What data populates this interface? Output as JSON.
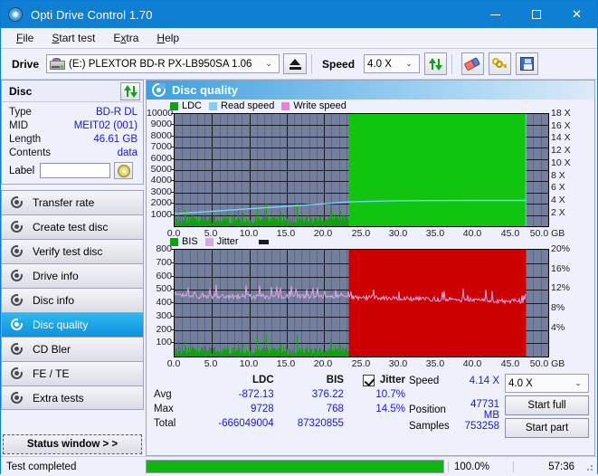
{
  "window": {
    "title": "Opti Drive Control 1.70",
    "icon": "disc-icon",
    "minimize": "minimize-icon",
    "maximize": "maximize-icon",
    "close": "close-icon"
  },
  "menu": [
    {
      "label": "File",
      "accel": "F"
    },
    {
      "label": "Start test",
      "accel": "S"
    },
    {
      "label": "Extra",
      "accel": "x"
    },
    {
      "label": "Help",
      "accel": "H"
    }
  ],
  "toolbar": {
    "drive_label": "Drive",
    "drive_value": "(E:)  PLEXTOR BD-R  PX-LB950SA 1.06",
    "eject": "eject-icon",
    "speed_label": "Speed",
    "speed_value": "4.0 X",
    "refresh": "refresh-icon",
    "erase": "eraser-icon",
    "keys": "keys-icon",
    "save": "save-icon"
  },
  "disc": {
    "header": "Disc",
    "refresh_icon": "refresh-icon",
    "rows": [
      {
        "key": "Type",
        "value": "BD-R DL"
      },
      {
        "key": "MID",
        "value": "MEIT02 (001)"
      },
      {
        "key": "Length",
        "value": "46.61 GB"
      },
      {
        "key": "Contents",
        "value": "data"
      }
    ],
    "label_key": "Label",
    "label_value": "",
    "label_placeholder": ""
  },
  "nav": {
    "items": [
      {
        "label": "Transfer rate",
        "active": false
      },
      {
        "label": "Create test disc",
        "active": false
      },
      {
        "label": "Verify test disc",
        "active": false
      },
      {
        "label": "Drive info",
        "active": false
      },
      {
        "label": "Disc info",
        "active": false
      },
      {
        "label": "Disc quality",
        "active": true
      },
      {
        "label": "CD Bler",
        "active": false
      },
      {
        "label": "FE / TE",
        "active": false
      },
      {
        "label": "Extra tests",
        "active": false
      }
    ],
    "status_window": "Status window > >"
  },
  "panel": {
    "title": "Disc quality",
    "icon": "disc-quality-icon"
  },
  "chart_data": [
    {
      "type": "area",
      "name": "ldc-chart",
      "title": "",
      "xlabel": "GB",
      "ylabel": "",
      "legend": [
        {
          "label": "LDC",
          "color": "#10a010"
        },
        {
          "label": "Read speed",
          "color": "#79d2f5"
        },
        {
          "label": "Write speed",
          "color": "#f07ae0"
        }
      ],
      "legend_position": "top-left",
      "grid": true,
      "xlim": [
        0,
        50
      ],
      "xticks": [
        "0.0",
        "5.0",
        "10.0",
        "15.0",
        "20.0",
        "25.0",
        "30.0",
        "35.0",
        "40.0",
        "45.0",
        "50.0 GB"
      ],
      "ylim": [
        0,
        10000
      ],
      "yticks": [
        "10000",
        "9000",
        "8000",
        "7000",
        "6000",
        "5000",
        "4000",
        "3000",
        "2000",
        "1000"
      ],
      "y2lim": [
        0,
        18
      ],
      "y2ticks": [
        "18 X",
        "16 X",
        "14 X",
        "12 X",
        "10 X",
        "8 X",
        "6 X",
        "4 X",
        "2 X"
      ],
      "series": [
        {
          "name": "LDC",
          "color": "#10a010",
          "type": "area",
          "note": "low scattered errors 0-23.3 GB, saturated full-scale block 23.3-47.0 GB",
          "x": [
            0,
            2,
            4,
            6,
            8,
            10,
            12,
            14,
            16,
            18,
            20,
            22,
            23.2,
            23.4,
            35,
            46.9,
            47.0
          ],
          "y": [
            180,
            210,
            160,
            230,
            190,
            250,
            200,
            240,
            300,
            260,
            380,
            520,
            700,
            10000,
            10000,
            10000,
            0
          ]
        },
        {
          "name": "Read speed",
          "color": "#79d2f5",
          "type": "line",
          "axis": "right",
          "x": [
            0,
            5,
            10,
            15,
            20,
            23.3,
            30,
            40,
            47
          ],
          "y": [
            2.0,
            2.4,
            2.8,
            3.2,
            3.6,
            3.9,
            4.1,
            4.14,
            4.14
          ]
        }
      ]
    },
    {
      "type": "area",
      "name": "bis-chart",
      "title": "",
      "xlabel": "GB",
      "ylabel": "",
      "legend": [
        {
          "label": "BIS",
          "color": "#10a010"
        },
        {
          "label": "Jitter",
          "color": "#d9a6e0"
        }
      ],
      "legend_position": "top-left",
      "grid": true,
      "xlim": [
        0,
        50
      ],
      "xticks": [
        "0.0",
        "5.0",
        "10.0",
        "15.0",
        "20.0",
        "25.0",
        "30.0",
        "35.0",
        "40.0",
        "45.0",
        "50.0 GB"
      ],
      "ylim": [
        0,
        800
      ],
      "yticks": [
        "800",
        "700",
        "600",
        "500",
        "400",
        "300",
        "200",
        "100"
      ],
      "y2lim": [
        0,
        20
      ],
      "y2ticks": [
        "20%",
        "16%",
        "12%",
        "8%",
        "4%"
      ],
      "series": [
        {
          "name": "BIS",
          "color": "#10a010",
          "over_limit_color": "#cc0000",
          "type": "area",
          "note": "low 0-23.3 GB green; over-limit saturated red block 23.3-47.0 GB",
          "x": [
            0,
            5,
            10,
            15,
            20,
            23.2,
            23.4,
            35,
            46.9,
            47.0
          ],
          "y": [
            20,
            25,
            18,
            30,
            35,
            60,
            800,
            800,
            800,
            0
          ]
        },
        {
          "name": "Jitter",
          "color": "#d9a6e0",
          "type": "line",
          "axis": "right",
          "x": [
            0,
            5,
            10,
            15,
            20,
            22,
            25,
            30,
            35,
            40,
            45,
            47
          ],
          "y": [
            11.0,
            11.2,
            11.0,
            11.3,
            11.5,
            12.0,
            11.0,
            10.6,
            10.5,
            10.4,
            10.5,
            10.4
          ]
        }
      ]
    }
  ],
  "stats": {
    "headers": {
      "ldc": "LDC",
      "bis": "BIS",
      "jitter": "Jitter"
    },
    "jitter_checked": true,
    "rows": [
      {
        "label": "Avg",
        "ldc": "-872.13",
        "bis": "376.22",
        "jitter": "10.7%"
      },
      {
        "label": "Max",
        "ldc": "9728",
        "bis": "768",
        "jitter": "14.5%"
      },
      {
        "label": "Total",
        "ldc": "-666049004",
        "bis": "87320855",
        "jitter": ""
      }
    ],
    "speed_label": "Speed",
    "speed_value": "4.14 X",
    "position_label": "Position",
    "position_value": "47731 MB",
    "samples_label": "Samples",
    "samples_value": "753258",
    "speed_select": "4.0 X",
    "start_full": "Start full",
    "start_part": "Start part"
  },
  "statusbar": {
    "text": "Test completed",
    "progress_pct": 100.0,
    "progress_label": "100.0%",
    "time": "57:36"
  }
}
